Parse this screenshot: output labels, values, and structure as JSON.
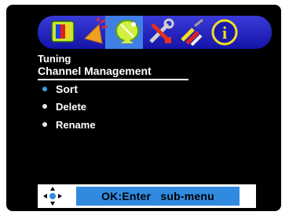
{
  "menu": {
    "tabs": [
      {
        "icon": "tv-picture-icon"
      },
      {
        "icon": "sound-icon"
      },
      {
        "icon": "satellite-dish-icon",
        "active": true
      },
      {
        "icon": "tools-icon"
      },
      {
        "icon": "av-cable-icon"
      },
      {
        "icon": "info-icon",
        "glyph": "i"
      }
    ],
    "breadcrumb": "Tuning",
    "title": "Channel Management",
    "items": [
      {
        "label": "Sort",
        "selected": true
      },
      {
        "label": "Delete",
        "selected": false
      },
      {
        "label": "Rename",
        "selected": false
      }
    ]
  },
  "footer": {
    "hint": "OK:Enter   sub-menu"
  },
  "colors": {
    "accent": "#2f8ae0",
    "bar": "#1e1eb8",
    "selected_bullet": "#3aa0e0"
  }
}
